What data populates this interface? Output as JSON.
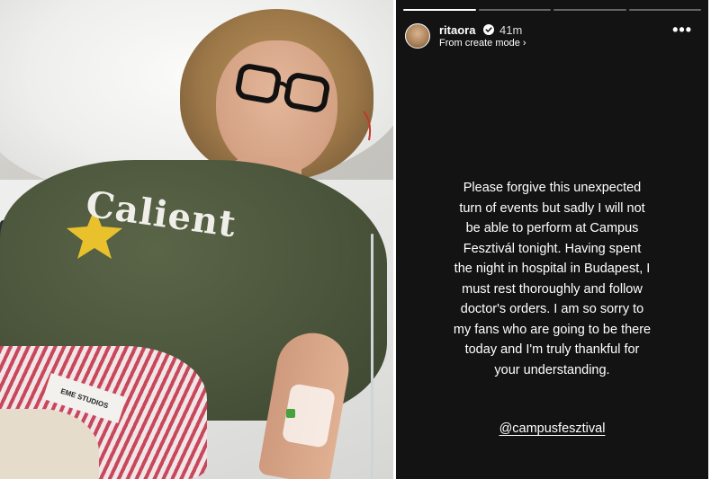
{
  "photo": {
    "hoodie_logo": "Calient",
    "tag_text": "EME STUDIOS"
  },
  "story": {
    "progress": {
      "segments": 4,
      "completed": 1
    },
    "header": {
      "username": "ritaora",
      "verified_icon": "verified-badge-icon",
      "time": "41m",
      "subline": "From create mode",
      "subline_chevron": "›",
      "more_icon": "more-options-icon",
      "more_text": "•••"
    },
    "message_lines": [
      "Please forgive this unexpected",
      "turn of events but sadly I will not",
      "be able to perform at Campus",
      "Fesztivál tonight. Having spent",
      "the night in hospital in Budapest, I",
      "must rest thoroughly and follow",
      "doctor's orders. I am so sorry to",
      "my fans who are going to be there",
      "today and I'm truly thankful for",
      "your understanding."
    ],
    "mention": "@campusfesztival",
    "colors": {
      "background": "#131313",
      "text": "#ffffff",
      "verified": "#3897f0"
    }
  }
}
